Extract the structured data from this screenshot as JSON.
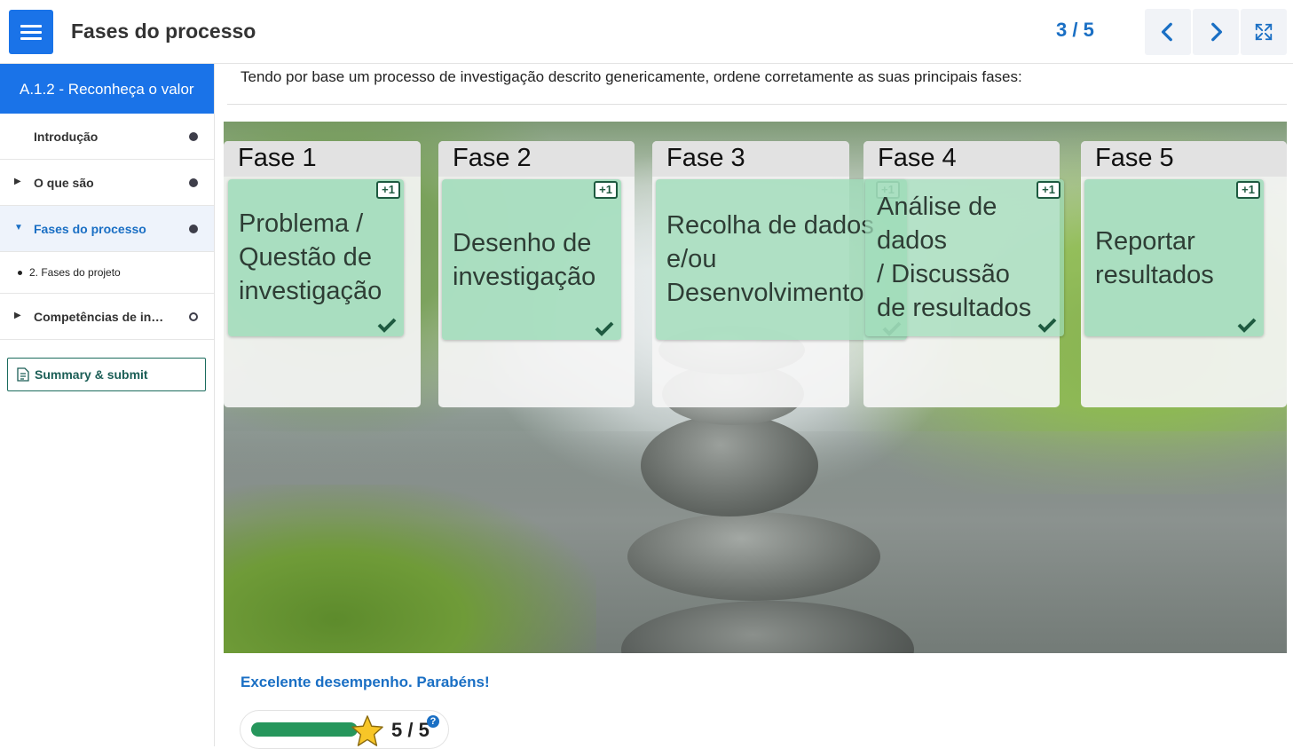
{
  "header": {
    "title": "Fases do processo",
    "counter": "3 / 5",
    "icons": {
      "menu": "hamburger-icon",
      "prev": "chevron-left-icon",
      "next": "chevron-right-icon",
      "fullscreen": "expand-icon"
    },
    "accent": "#1a73e8"
  },
  "sidebar": {
    "course_title": "A.1.2 - Reconheça o valor",
    "items": [
      {
        "label": "Introdução",
        "status": "filled"
      },
      {
        "label": "O que são",
        "status": "filled"
      },
      {
        "label": "Fases do processo",
        "status": "filled"
      },
      {
        "label": "Competências de investigação",
        "status": "empty"
      }
    ],
    "subitem": "2. Fases do projeto",
    "summary_label": "Summary & submit"
  },
  "content": {
    "question": "Tendo por base um processo de investigação descrito genericamente, ordene corretamente as suas principais fases:",
    "phases": [
      "Fase 1",
      "Fase 2",
      "Fase 3",
      "Fase 4",
      "Fase 5"
    ],
    "cards": [
      {
        "lines": [
          "Problema /",
          "Questão de",
          "investigação"
        ],
        "badge": "+1"
      },
      {
        "lines": [
          "Desenho de",
          "investigação"
        ],
        "badge": "+1"
      },
      {
        "lines": [
          "Recolha de dados",
          "e/ou",
          "Desenvolvimento"
        ],
        "badge": "+1"
      },
      {
        "lines": [
          "Análise de",
          "dados",
          "/  Discussão",
          "de resultados"
        ],
        "badge": "+1"
      },
      {
        "lines": [
          "Reportar",
          "resultados"
        ],
        "badge": "+1"
      }
    ],
    "feedback": "Excelente desempenho. Parabéns!",
    "score": "5 / 5",
    "score_fraction": 1.0,
    "help": "?",
    "card_color": "#9edbb8",
    "success_color": "#26965c"
  }
}
